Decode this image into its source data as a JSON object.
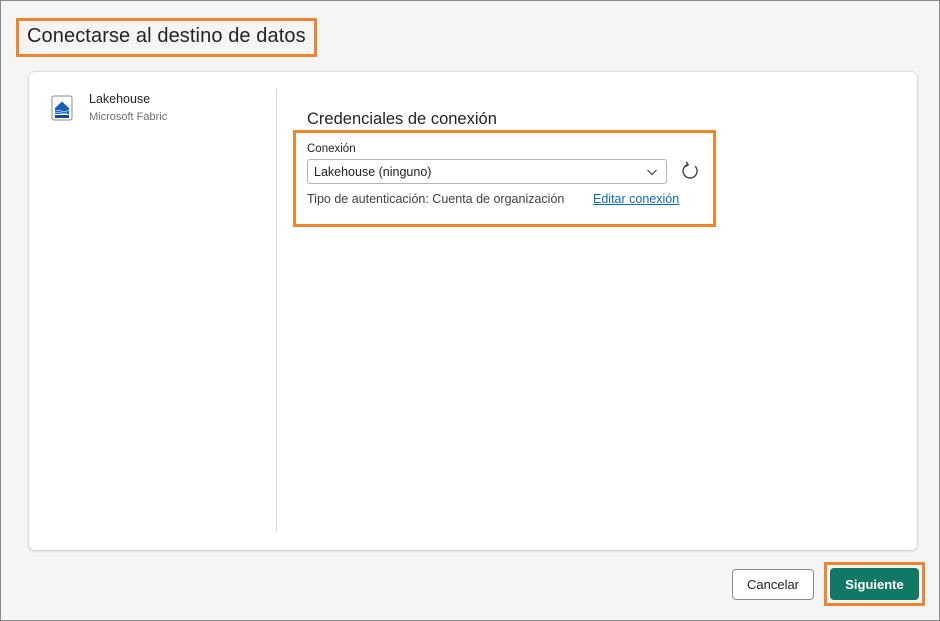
{
  "dialog": {
    "title": "Conectarse al destino de datos"
  },
  "sidebar": {
    "items": [
      {
        "label": "Lakehouse",
        "sublabel": "Microsoft Fabric",
        "icon": "lakehouse-icon"
      }
    ]
  },
  "credentials": {
    "section_title": "Credenciales de conexión",
    "connection_label": "Conexión",
    "connection_value": "Lakehouse (ninguno)",
    "auth_text": "Tipo de autenticación: Cuenta de organización",
    "edit_link": "Editar conexión"
  },
  "footer": {
    "cancel_label": "Cancelar",
    "next_label": "Siguiente"
  },
  "colors": {
    "highlight": "#f0852e",
    "primary": "#117865",
    "link": "#0f6cbd"
  }
}
